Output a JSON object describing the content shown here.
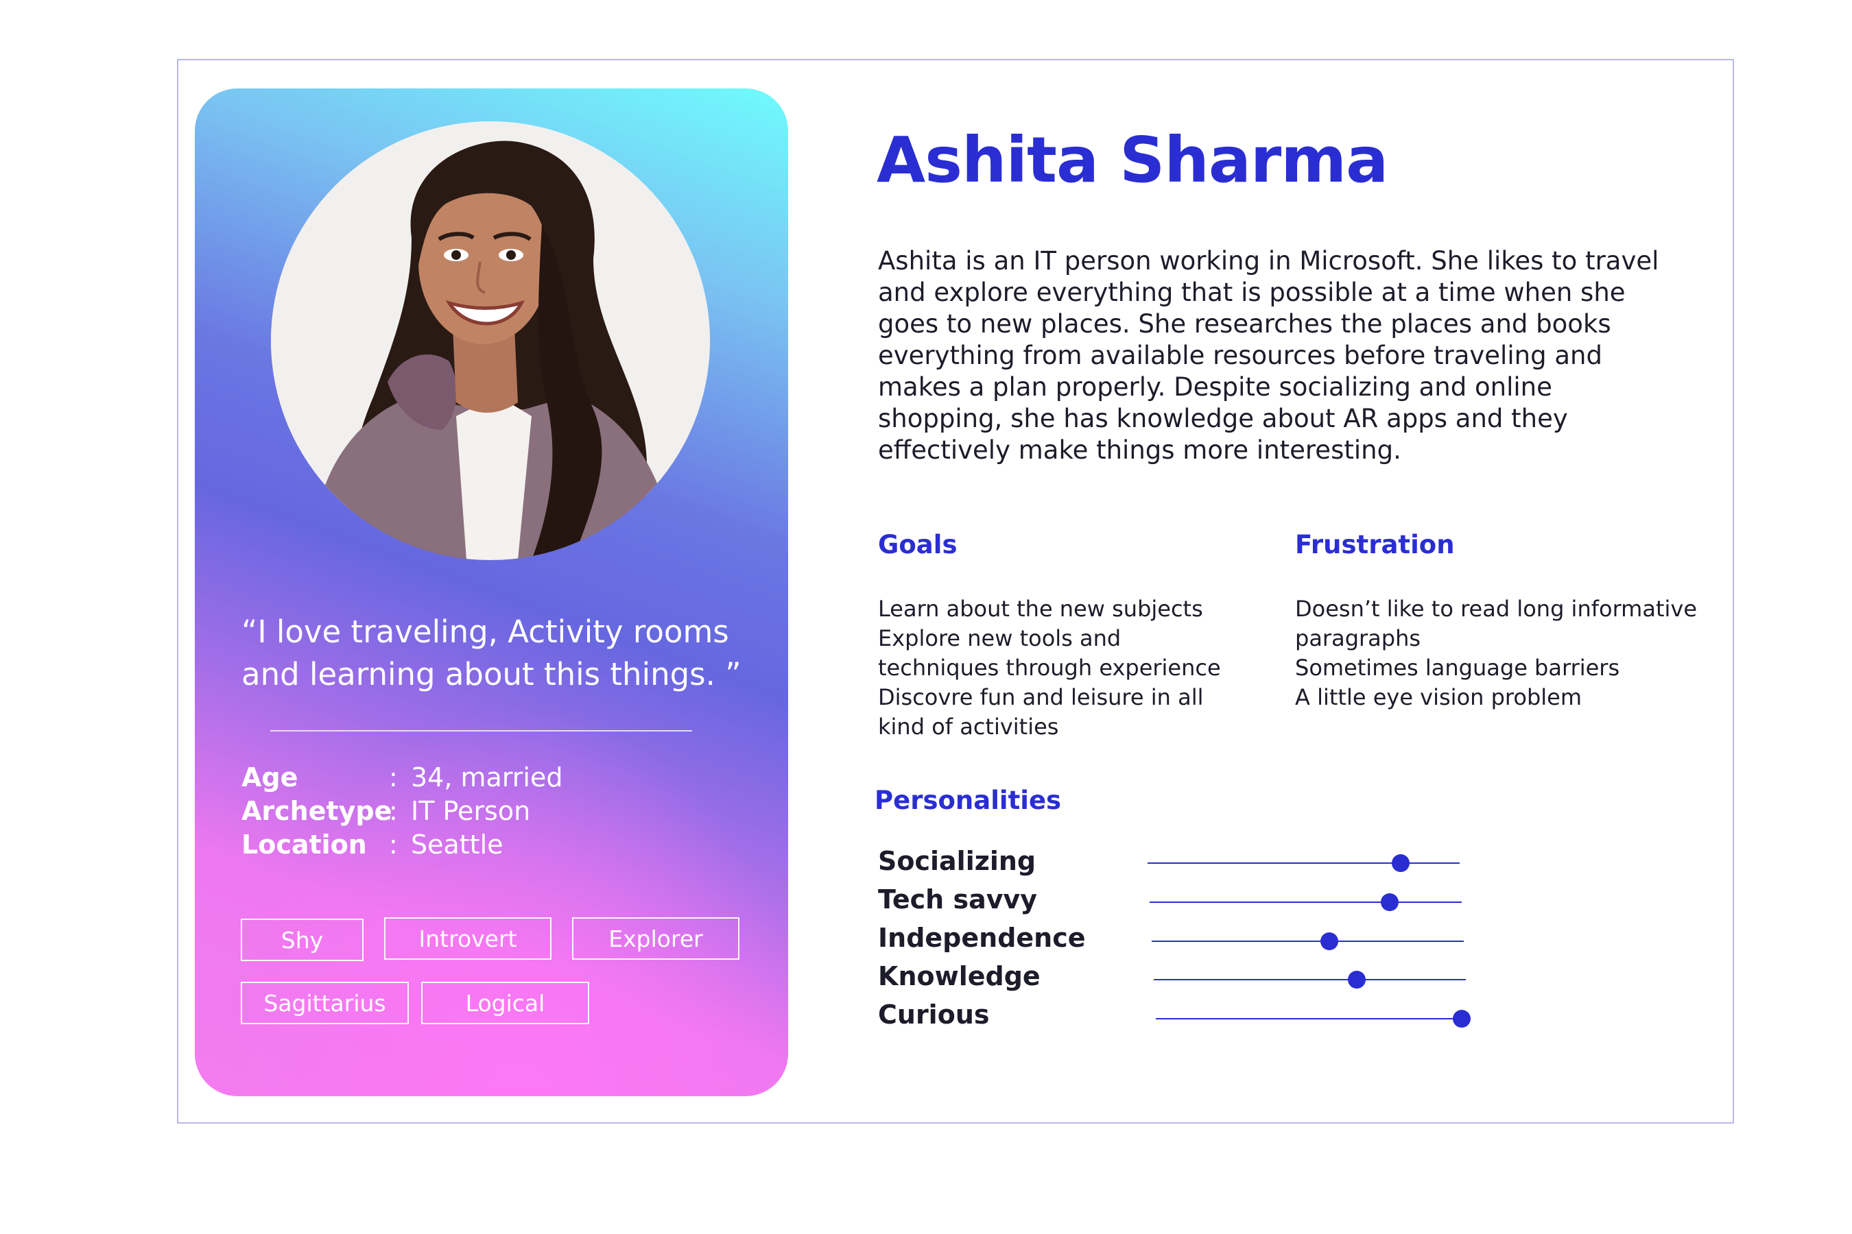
{
  "persona": {
    "name": "Ashita Sharma",
    "bio": "Ashita is an IT person working in Microsoft. She likes to travel and explore everything that is possible at a time when she goes to new places. She researches the places and books everything from available resources before traveling and makes a plan properly. Despite socializing and online shopping, she has knowledge about AR apps and they effectively make things more interesting.",
    "quote": "“I love traveling, Activity rooms and learning about this things. ”"
  },
  "info": [
    {
      "key": "Age",
      "value": "34, married"
    },
    {
      "key": "Archetype",
      "value": "IT Person"
    },
    {
      "key": "Location",
      "value": "Seattle"
    }
  ],
  "tags": [
    "Shy",
    "Introvert",
    "Explorer",
    "Sagittarius",
    "Logical"
  ],
  "goals": {
    "title": "Goals",
    "lines": [
      "Learn about  the new subjects",
      "Explore new tools and",
      "techniques through experience",
      "Discovre fun and leisure in all",
      "kind of activities"
    ]
  },
  "frustration": {
    "title": "Frustration",
    "lines": [
      "Doesn’t like to read long informative",
      "paragraphs",
      "Sometimes language barriers",
      "A little eye vision problem"
    ]
  },
  "personalities": {
    "title": "Personalities",
    "traits": [
      {
        "label": "Socializing",
        "level": 0.81
      },
      {
        "label": "Tech savvy",
        "level": 0.77
      },
      {
        "label": "Independence",
        "level": 0.57
      },
      {
        "label": "Knowledge",
        "level": 0.65
      },
      {
        "label": "Curious",
        "level": 0.98
      }
    ]
  },
  "colors": {
    "accent": "#2a2ed2",
    "gradient_top": "#6ffcfd",
    "gradient_mid": "#6667e0",
    "gradient_bottom": "#f47cf0"
  },
  "icons": {
    "portrait": "woman-portrait-photo"
  }
}
